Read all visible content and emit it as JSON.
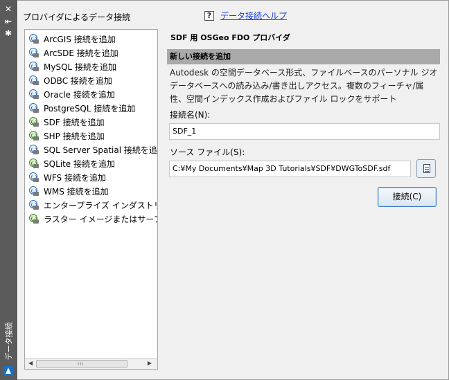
{
  "palette": {
    "title": "データ接続",
    "close_glyph": "✕",
    "autohide_glyph": "⇤",
    "properties_glyph": "✱"
  },
  "left": {
    "title": "プロバイダによるデータ接続"
  },
  "help": {
    "icon_glyph": "?",
    "link_text": "データ接続ヘルプ"
  },
  "providers": [
    {
      "label": "ArcGIS 接続を追加",
      "icon": "connection-icon"
    },
    {
      "label": "ArcSDE 接続を追加",
      "icon": "connection-icon"
    },
    {
      "label": "MySQL 接続を追加",
      "icon": "connection-icon"
    },
    {
      "label": "ODBC 接続を追加",
      "icon": "connection-icon"
    },
    {
      "label": "Oracle 接続を追加",
      "icon": "connection-icon"
    },
    {
      "label": "PostgreSQL 接続を追加",
      "icon": "connection-icon"
    },
    {
      "label": "SDF 接続を追加",
      "icon": "sdf-connection-icon"
    },
    {
      "label": "SHP 接続を追加",
      "icon": "shp-connection-icon"
    },
    {
      "label": "SQL Server Spatial 接続を追",
      "icon": "connection-icon"
    },
    {
      "label": "SQLite 接続を追加",
      "icon": "sqlite-connection-icon"
    },
    {
      "label": "WFS 接続を追加",
      "icon": "connection-icon"
    },
    {
      "label": "WMS 接続を追加",
      "icon": "connection-icon"
    },
    {
      "label": "エンタープライズ インダストリ",
      "icon": "connection-icon"
    },
    {
      "label": "ラスター イメージまたはサーフ",
      "icon": "raster-connection-icon"
    }
  ],
  "scrollbar": {
    "left_arrow": "◀",
    "right_arrow": "▶",
    "grip": "III"
  },
  "panel": {
    "provider_title": "SDF 用 OSGeo FDO プロバイダ",
    "section_header": "新しい接続を追加",
    "description": "Autodesk の空間データベース形式、ファイルベースのパーソナル ジオデータベースへの読み込み/書き出しアクセス。複数のフィーチャ/属性、空間インデックス作成およびファイル ロックをサポート",
    "connection_name_label": "接続名(N):",
    "connection_name_value": "SDF_1",
    "source_file_label": "ソース ファイル(S):",
    "source_file_value": "C:¥My Documents¥Map 3D Tutorials¥SDF¥DWGToSDF.sdf",
    "connect_label": "接続(C)"
  },
  "colors": {
    "link": "#1a3fd6",
    "section_header_bg": "#a9a9a9",
    "palette_bar": "#5a5a5a"
  }
}
